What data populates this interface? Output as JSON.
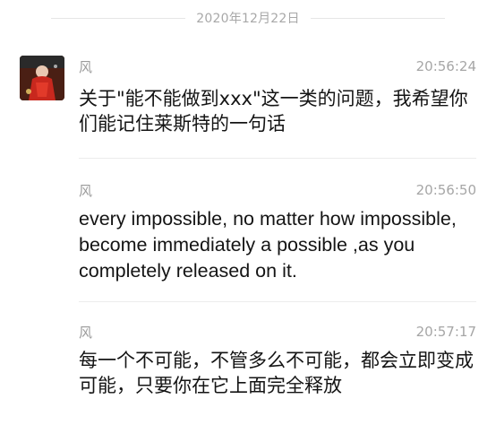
{
  "date_header": "2020年12月22日",
  "messages": [
    {
      "sender": "风",
      "time": "20:56:24",
      "text": "关于\"能不能做到xxx\"这一类的问题，我希望你们能记住莱斯特的一句话",
      "has_avatar": true
    },
    {
      "sender": "风",
      "time": "20:56:50",
      "text": "every impossible, no matter how impossible, become immediately a possible ,as you completely released on it."
    },
    {
      "sender": "风",
      "time": "20:57:17",
      "text": "每一个不可能，不管多么不可能，都会立即变成可能，只要你在它上面完全释放"
    }
  ],
  "colors": {
    "background": "#ffffff",
    "meta_text": "#a6a6a6",
    "message_text": "#141414",
    "divider": "#ececec"
  }
}
